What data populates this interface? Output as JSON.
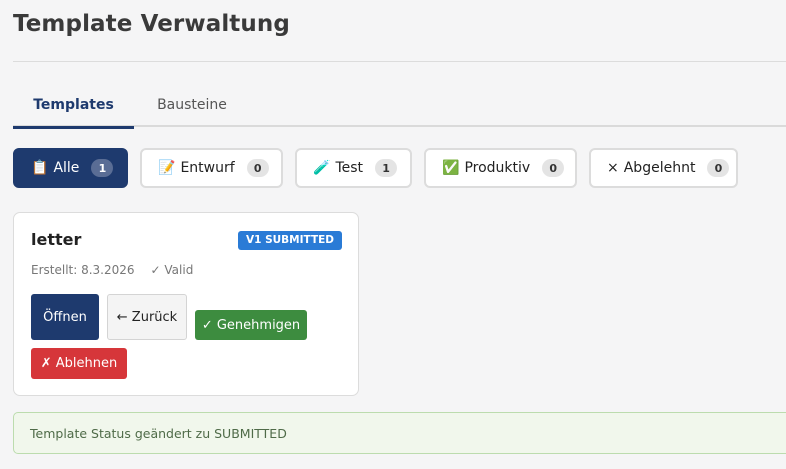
{
  "page": {
    "title": "Template Verwaltung"
  },
  "tabs": [
    {
      "label": "Templates",
      "active": true
    },
    {
      "label": "Bausteine",
      "active": false
    }
  ],
  "filters": [
    {
      "icon": "📋",
      "label": "Alle",
      "count": "1",
      "active": true
    },
    {
      "icon": "📝",
      "label": "Entwurf",
      "count": "0",
      "active": false
    },
    {
      "icon": "🧪",
      "label": "Test",
      "count": "1",
      "active": false
    },
    {
      "icon": "✅",
      "label": "Produktiv",
      "count": "0",
      "active": false
    },
    {
      "icon": "×",
      "label": "Abgelehnt",
      "count": "0",
      "active": false
    }
  ],
  "card": {
    "title": "letter",
    "badge": "V1 SUBMITTED",
    "created": "Erstellt: 8.3.2026",
    "valid": "✓ Valid",
    "buttons": {
      "open": "Öffnen",
      "back": "← Zurück",
      "approve": "✓ Genehmigen",
      "reject": "✗ Ablehnen"
    }
  },
  "alert": {
    "message": "Template Status geändert zu SUBMITTED"
  },
  "colors": {
    "primary": "#1e3a6e",
    "badge": "#2a7bd6",
    "success": "#3d8c3f",
    "danger": "#d6363a",
    "alert_bg": "#f1f7ec"
  }
}
